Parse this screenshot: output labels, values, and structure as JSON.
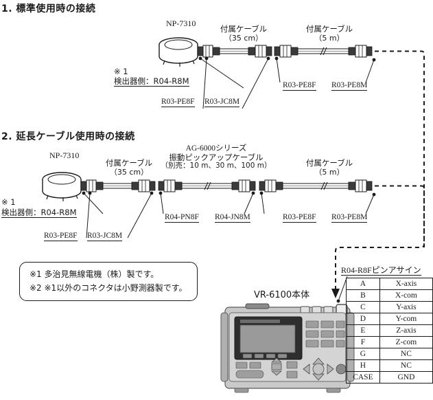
{
  "sections": [
    {
      "title": "1. 標準使用時の接続",
      "sensor_label": "NP-7310",
      "note1_mark": "※ 1",
      "note1_text": "検出器側：R04-R8M",
      "cables": [
        {
          "name": "付属ケーブル",
          "length": "（35 cm）"
        },
        {
          "name": "付属ケーブル",
          "length": "（5 m）"
        }
      ],
      "connectors": [
        "R03-PE8F",
        "R03-JC8M",
        "R03-PE8F",
        "R03-PE8M"
      ]
    },
    {
      "title": "2. 延長ケーブル使用時の接続",
      "sensor_label": "NP-7310",
      "note1_mark": "※ 1",
      "note1_text": "検出器側：R04-R8M",
      "cables": [
        {
          "name": "付属ケーブル",
          "length": "（35 cm）"
        },
        {
          "name": "AG-6000シリーズ",
          "name2": "振動ピックアップケーブル",
          "length": "（別売：10 m、30 m、100 m）"
        },
        {
          "name": "付属ケーブル",
          "length": "（5 m）"
        }
      ],
      "connectors": [
        "R03-PE8F",
        "R03-JC8M",
        "R04-PN8F",
        "R04-JN8M",
        "R03-PE8F",
        "R03-PE8M"
      ]
    }
  ],
  "notebox": {
    "line1": "※1  多治見無線電機（株）製です。",
    "line2": "※2 ※1以外のコネクタは小野測器製です。"
  },
  "device": {
    "label": "VR-6100本体"
  },
  "pin_table": {
    "heading": "R04-R8Fピンアサイン",
    "rows": [
      {
        "pin": "A",
        "signal": "X-axis"
      },
      {
        "pin": "B",
        "signal": "X-com"
      },
      {
        "pin": "C",
        "signal": "Y-axis"
      },
      {
        "pin": "D",
        "signal": "Y-com"
      },
      {
        "pin": "E",
        "signal": "Z-axis"
      },
      {
        "pin": "F",
        "signal": "Z-com"
      },
      {
        "pin": "G",
        "signal": "NC"
      },
      {
        "pin": "H",
        "signal": "NC"
      },
      {
        "pin": "CASE",
        "signal": "GND"
      }
    ]
  },
  "colors": {
    "ink": "#1a1a1a",
    "connector_dark": "#3a3a3a",
    "device_body": "#bcbcbc",
    "device_screen": "#8f8f8f"
  }
}
